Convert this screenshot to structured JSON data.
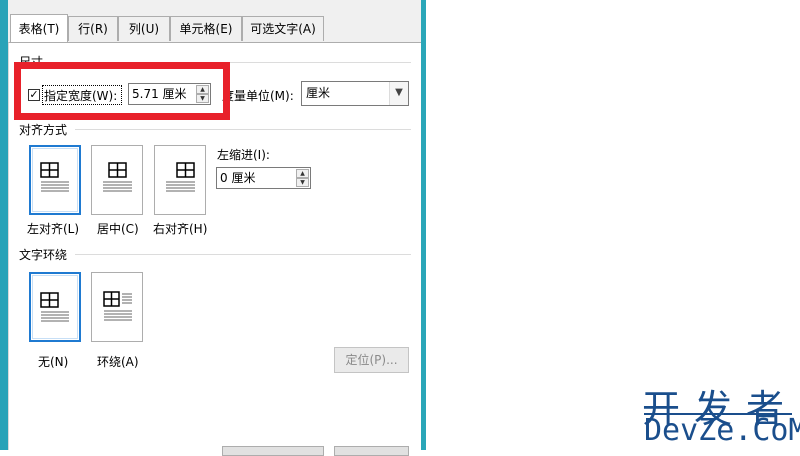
{
  "tabs": [
    {
      "label": "表格(T)"
    },
    {
      "label": "行(R)"
    },
    {
      "label": "列(U)"
    },
    {
      "label": "单元格(E)"
    },
    {
      "label": "可选文字(A)"
    }
  ],
  "active_tab": "表格(T)",
  "size": {
    "group_title": "尺寸",
    "specify_width_label": "指定宽度(W):",
    "specify_width_checked": true,
    "width_value": "5.71 厘米",
    "unit_label": "度量单位(M):",
    "unit_value": "厘米"
  },
  "alignment": {
    "group_title": "对齐方式",
    "options": [
      {
        "label": "左对齐(L)",
        "selected": true
      },
      {
        "label": "居中(C)",
        "selected": false
      },
      {
        "label": "右对齐(H)",
        "selected": false
      }
    ],
    "indent_label": "左缩进(I):",
    "indent_value": "0 厘米"
  },
  "wrap": {
    "group_title": "文字环绕",
    "options": [
      {
        "label": "无(N)",
        "selected": true
      },
      {
        "label": "环绕(A)",
        "selected": false
      }
    ],
    "position_button": "定位(P)..."
  },
  "watermark": {
    "line1": "开发者",
    "line2": "DevZe.CoM"
  },
  "colors": {
    "highlight": "#e8212a",
    "accent_blue": "#1f7ad1",
    "edge_teal": "#2aa6b8"
  }
}
